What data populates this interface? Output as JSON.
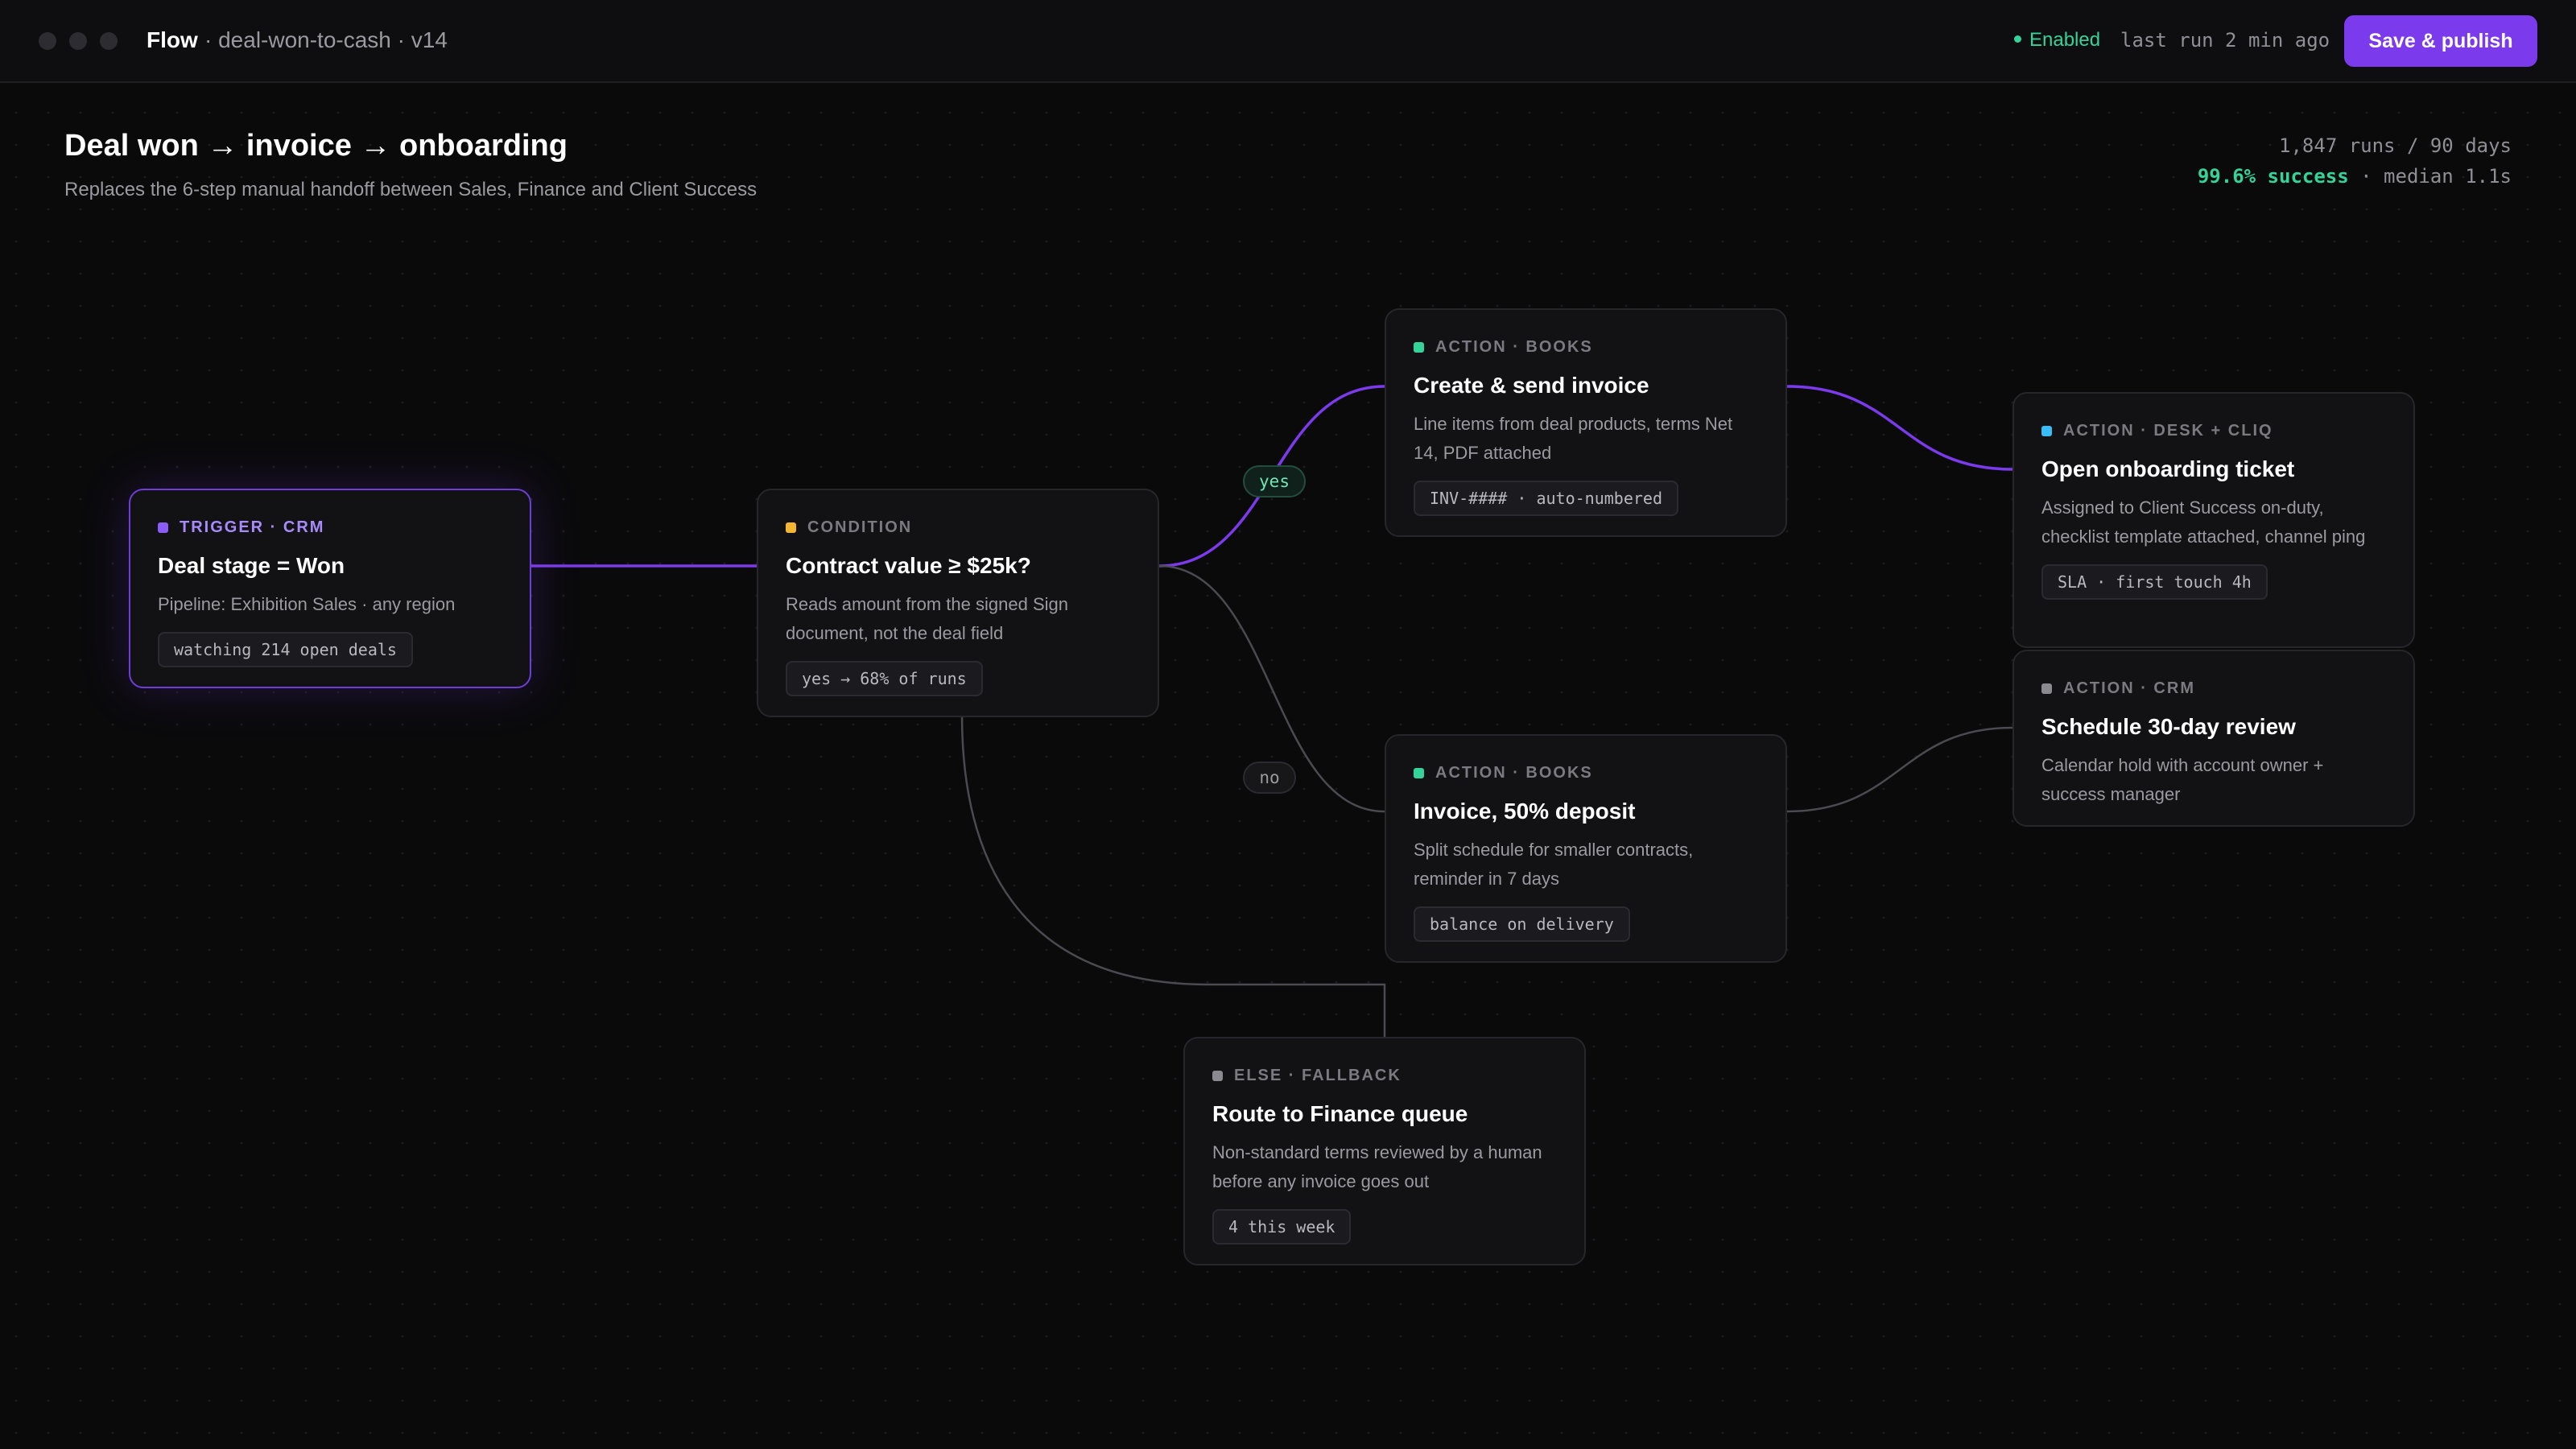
{
  "window": {
    "app_name": "Flow",
    "path": "· deal-won-to-cash · v14"
  },
  "toolbar": {
    "status": "Enabled",
    "last_run": "last run 2 min ago",
    "publish_label": "Save & publish"
  },
  "header": {
    "title": "Deal won → invoice → onboarding",
    "subtitle": "Replaces the 6-step manual handoff between Sales, Finance and Client Success",
    "runs": "1,847 runs / 90 days",
    "success": "99.6% success",
    "median": "· median 1.1s"
  },
  "colors": {
    "accent": "#7c3aed",
    "success": "#34d399",
    "condition": "#f5b731",
    "desk": "#38bdf8",
    "neutral": "#8a8a90"
  },
  "nodes": {
    "trigger": {
      "kicker": "TRIGGER · CRM",
      "title": "Deal stage = Won",
      "desc": "Pipeline: Exhibition Sales · any region",
      "pill": "watching 214 open deals"
    },
    "condition": {
      "kicker": "CONDITION",
      "title": "Contract value ≥ $25k?",
      "desc": "Reads amount from the signed Sign document, not the deal field",
      "pill": "yes → 68% of runs"
    },
    "invoice": {
      "kicker": "ACTION · BOOKS",
      "title": "Create & send invoice",
      "desc": "Line items from deal products, terms Net 14, PDF attached",
      "pill": "INV-#### · auto-numbered"
    },
    "deposit": {
      "kicker": "ACTION · BOOKS",
      "title": "Invoice, 50% deposit",
      "desc": "Split schedule for smaller contracts, reminder in 7 days",
      "pill": "balance on delivery"
    },
    "onboarding": {
      "kicker": "ACTION · DESK + CLIQ",
      "title": "Open onboarding ticket",
      "desc": "Assigned to Client Success on-duty, checklist template attached, channel ping",
      "pill": "SLA · first touch 4h"
    },
    "review": {
      "kicker": "ACTION · CRM",
      "title": "Schedule 30-day review",
      "desc": "Calendar hold with account owner + success manager"
    },
    "fallback": {
      "kicker": "ELSE · FALLBACK",
      "title": "Route to Finance queue",
      "desc": "Non-standard terms reviewed by a human before any invoice goes out",
      "pill": "4 this week"
    }
  },
  "edges": {
    "yes_label": "yes",
    "no_label": "no"
  }
}
